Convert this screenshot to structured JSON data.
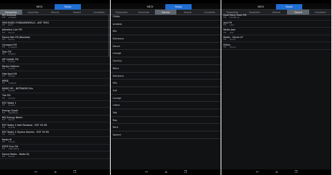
{
  "panels": [
    {
      "top_tabs": [
        "",
        "RBTX",
        "Radio",
        ""
      ],
      "selected_top_tab": 2,
      "sub_tabs": [
        "Favourites",
        "Countries",
        "Genres",
        "Search",
        "Countries"
      ],
      "selected_sub_tab": 0,
      "stations": [
        {
          "name": "NPJ Arabesk",
          "m1": "FM",
          "m2": "Arabesk"
        },
        {
          "name": "SIIM RADIO FUNDAMENTALS - ANT TEKS",
          "m1": "FM",
          "m2": "Rock"
        },
        {
          "name": "Jalinatea Live FM",
          "m1": "FM",
          "m2": "Dance"
        },
        {
          "name": "Dance Net FM (Bavaria)",
          "m1": "FM",
          "m2": "Dance"
        },
        {
          "name": "Compact FM",
          "m1": "FM",
          "m2": "Compact"
        },
        {
          "name": "Siav FM",
          "m1": "FM",
          "m2": "Rhythm"
        },
        {
          "name": "ISP SAKAR FM",
          "m1": "FM",
          "m2": "Turkish"
        },
        {
          "name": "Radyo Seferen",
          "m1": "FM",
          "m2": "Turkish"
        },
        {
          "name": "Fitie Kozt FM",
          "m1": "FM",
          "m2": "Turkish"
        },
        {
          "name": "NPAD",
          "m1": "FM",
          "m2": "Arabesk"
        },
        {
          "name": "RADIO RS - NETRADIO Khz",
          "m1": "FM",
          "m2": "Turkish"
        },
        {
          "name": "Tiie FM",
          "m1": "FM",
          "m2": "Turkish"
        },
        {
          "name": "RST Radio 1",
          "m1": "FM",
          "m2": "Turkish"
        },
        {
          "name": "Energy Clasik",
          "m1": "FM",
          "m2": "Jazz/Blues"
        },
        {
          "name": "BRJ Energy Berlin",
          "m1": "FM",
          "m2": "Dance"
        },
        {
          "name": "RST Radio 3 Halt Rainbow - RST 92.98",
          "m1": "FM",
          "m2": "Turkish"
        },
        {
          "name": "RST Radio 2 Skysha Buntan - RST 92.98",
          "m1": "FM",
          "m2": "Turkish"
        },
        {
          "name": "Radio M",
          "m1": "FM",
          "m2": "Turkish"
        },
        {
          "name": "NTEP Turn FM",
          "m1": "FM",
          "m2": "Alternative"
        },
        {
          "name": "Dance Radio - Radio DJ",
          "m1": "FM",
          "m2": "Dance"
        }
      ]
    },
    {
      "top_tabs": [
        "",
        "RBTX",
        "Radio",
        ""
      ],
      "selected_top_tab": 2,
      "sub_tabs": [
        "Favourites",
        "Countries",
        "Genres",
        "Search",
        "Countries"
      ],
      "selected_sub_tab": 2,
      "genres": [
        "Oldies",
        "Arabesk",
        "80s",
        "Electronic",
        "Dance",
        "Lounge",
        "Country",
        "Retro",
        "Electronic",
        "Hits",
        "Sufi",
        "Lounge",
        "Latino",
        "Talk",
        "Rap",
        "Rock",
        "Speech"
      ]
    },
    {
      "top_tabs": [
        "",
        "RBTX",
        "Radio",
        ""
      ],
      "selected_top_tab": 2,
      "sub_tabs": [
        "Favourites",
        "Countries",
        "Genres",
        "Search",
        "Countries"
      ],
      "selected_sub_tab": 3,
      "stations": [
        {
          "name": "Dark Party Punk FM",
          "m1": "FM",
          "m2": "Sweeping"
        },
        {
          "name": "Jost FM",
          "m1": "FM",
          "m2": "Latin"
        },
        {
          "name": "Radio Jazz",
          "m1": "FM",
          "m2": "Jazz"
        },
        {
          "name": "Radio - Genre LP",
          "m1": "FM",
          "m2": "Genre"
        },
        {
          "name": "Elikhu",
          "m1": "FM",
          "m2": "Sound"
        }
      ]
    }
  ],
  "nav_icons": [
    "back-icon",
    "home-icon",
    "recent-apps-icon"
  ],
  "colors": {
    "selected_tab": "#1f6ed3",
    "background": "#111214",
    "selected_subtab": "#5f656c"
  }
}
